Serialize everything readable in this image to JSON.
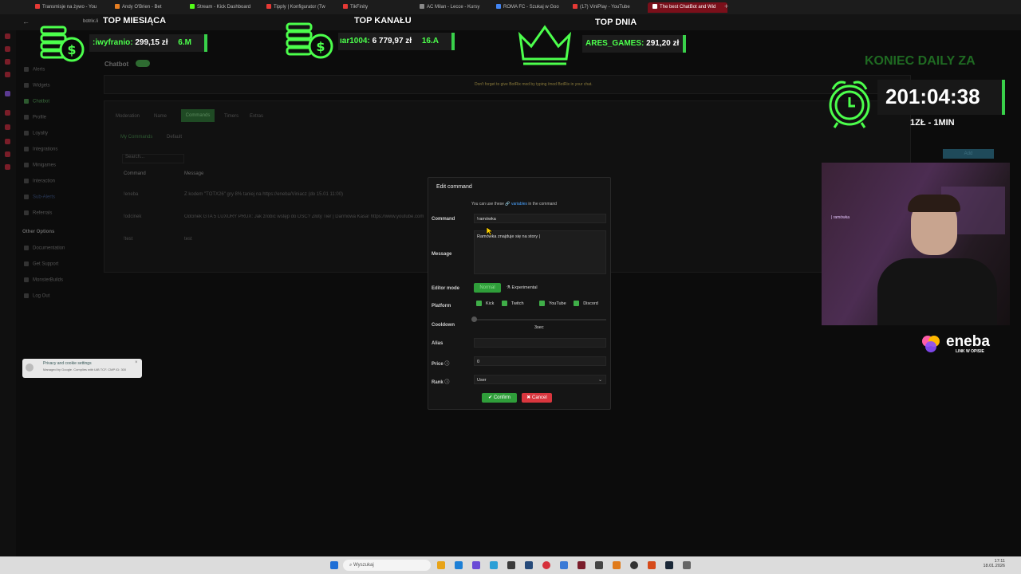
{
  "browser": {
    "tabs": [
      {
        "label": "Transmisje na żywo - You",
        "color": "#e53935"
      },
      {
        "label": "Andy O'Brien - Bet",
        "color": "#e67e22"
      },
      {
        "label": "Stream - Kick Dashboard",
        "color": "#53fc18"
      },
      {
        "label": "Tipply | Konfigurator (Tw",
        "color": "#e53935"
      },
      {
        "label": "TikFinity",
        "color": "#e53935"
      },
      {
        "label": "AC Milan - Lecce - Kursy",
        "color": "#888888"
      },
      {
        "label": "ROMA FC - Szukaj w Goo",
        "color": "#4285f4"
      },
      {
        "label": "(17) ViniPlay - YouTube",
        "color": "#e53935"
      },
      {
        "label": "The best ChatBot and Wid",
        "color": "#e53935"
      }
    ],
    "url": "botrix.li"
  },
  "overlay": {
    "top_month": {
      "title": "TOP MIESIĄCA",
      "name": ":iwyfranio:",
      "amount": "299,15 zł",
      "extra": "6.M"
    },
    "top_channel": {
      "title": "TOP KANAŁU",
      "name": "ıar1004:",
      "amount": "6 779,97 zł",
      "extra": "16.A"
    },
    "top_day": {
      "title": "TOP DNIA",
      "name": "ARES_GAMES:",
      "amount": "291,20 zł"
    },
    "countdown_title": "KONIEC DAILY ZA",
    "timer": "201:04:38",
    "rate": "1ZŁ - 1MIN",
    "sponsor": "eneba",
    "sponsor_sub": "LINK W OPISIE"
  },
  "dashboard": {
    "page_title": "Chatbot",
    "notice": "Don't forget to give BotRix mod by typing /mod BotRix in your chat.",
    "sidebar": [
      "Alerts",
      "Widgets",
      "Chatbot",
      "Profile",
      "Loyalty",
      "Integrations",
      "Minigames",
      "Interaction",
      "Sub-Alerts",
      "Referrals"
    ],
    "other_title": "Other Options",
    "other_items": [
      "Documentation",
      "Get Support",
      "MonsterBuilds",
      "Log Out"
    ],
    "tabs": [
      "Moderation",
      "Name",
      "Commands",
      "Timers",
      "Extras"
    ],
    "subtabs": [
      "My Commands",
      "Default"
    ],
    "search_placeholder": "Search...",
    "columns": [
      "Command",
      "Message"
    ],
    "rows": [
      {
        "cmd": "!eneba",
        "msg": "Z kodem \"TOTX26\" gry 8% taniej na https://eneba/Viniacz (do 15.01 11:00)"
      },
      {
        "cmd": "!odcinek",
        "msg": "Odcinek GTA 5 LUXURY PRUX: Jak zrobić wstęp do DSC? Złoty Tier | Darmowa Kasa! https://www.youtube.com"
      },
      {
        "cmd": "!test",
        "msg": "test"
      }
    ],
    "add_label": "Add",
    "cookie_title": "Privacy and cookie settings",
    "cookie_text": "Managed by Google. Complies with IAB TCF. CMP ID: 300"
  },
  "modal": {
    "title": "Edit command",
    "hint_pre": "You can use these",
    "hint_link": "variables",
    "hint_post": "in the command",
    "command_label": "Command",
    "command_value": "!ramówka",
    "message_label": "Message",
    "message_value": "Ramówka znajduje się na story |",
    "editor_label": "Editor mode",
    "editor_normal": "Normal",
    "editor_experimental": "Experimental",
    "platform_label": "Platform",
    "platforms": [
      "Kick",
      "Twitch",
      "YouTube",
      "Discord"
    ],
    "cooldown_label": "Cooldown",
    "cooldown_value": "3sec",
    "alias_label": "Alias",
    "price_label": "Price",
    "price_value": "0",
    "rank_label": "Rank",
    "rank_value": "User",
    "confirm_label": "Confirm",
    "cancel_label": "Cancel"
  },
  "taskbar": {
    "search_placeholder": "Wyszukaj",
    "time": "17:11",
    "date": "18.01.2026"
  }
}
